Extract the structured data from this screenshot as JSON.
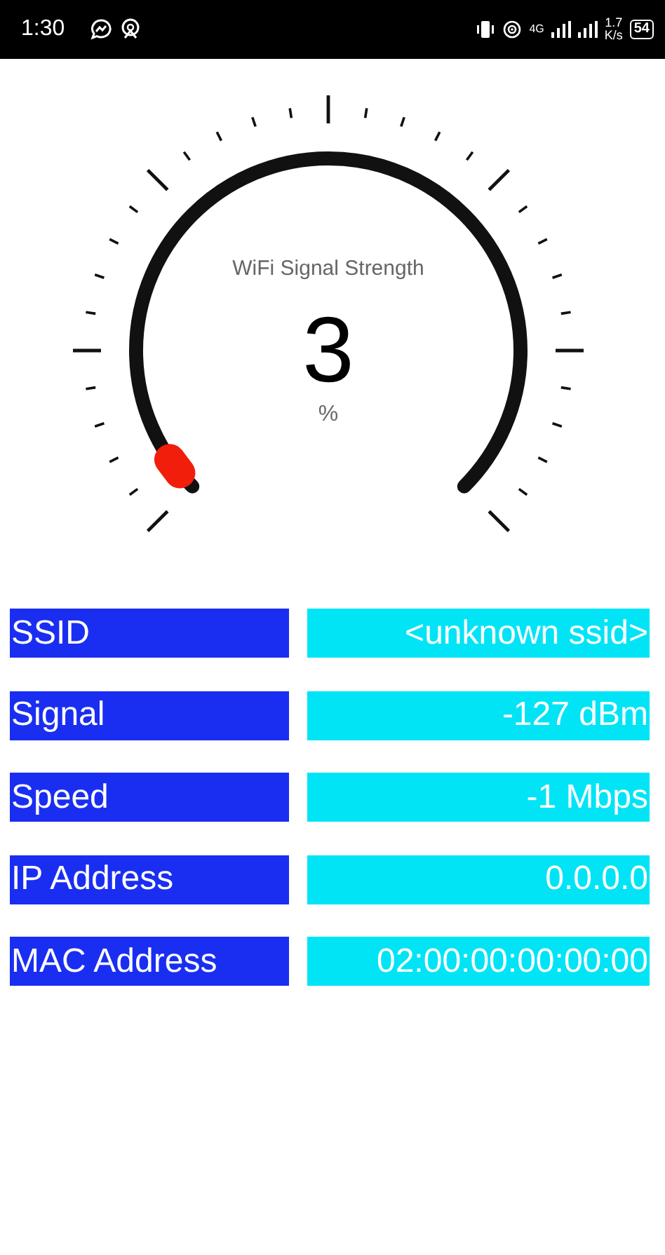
{
  "status_bar": {
    "time": "1:30",
    "network": "4G",
    "speed_value": "1.7",
    "speed_unit": "K/s",
    "battery": "54"
  },
  "gauge": {
    "title": "WiFi Signal Strength",
    "value": "3",
    "unit": "%"
  },
  "rows": [
    {
      "label": "SSID",
      "value": "<unknown ssid>"
    },
    {
      "label": "Signal",
      "value": "-127 dBm"
    },
    {
      "label": "Speed",
      "value": "-1 Mbps"
    },
    {
      "label": "IP Address",
      "value": "0.0.0.0"
    },
    {
      "label": "MAC Address",
      "value": "02:00:00:00:00:00"
    }
  ]
}
